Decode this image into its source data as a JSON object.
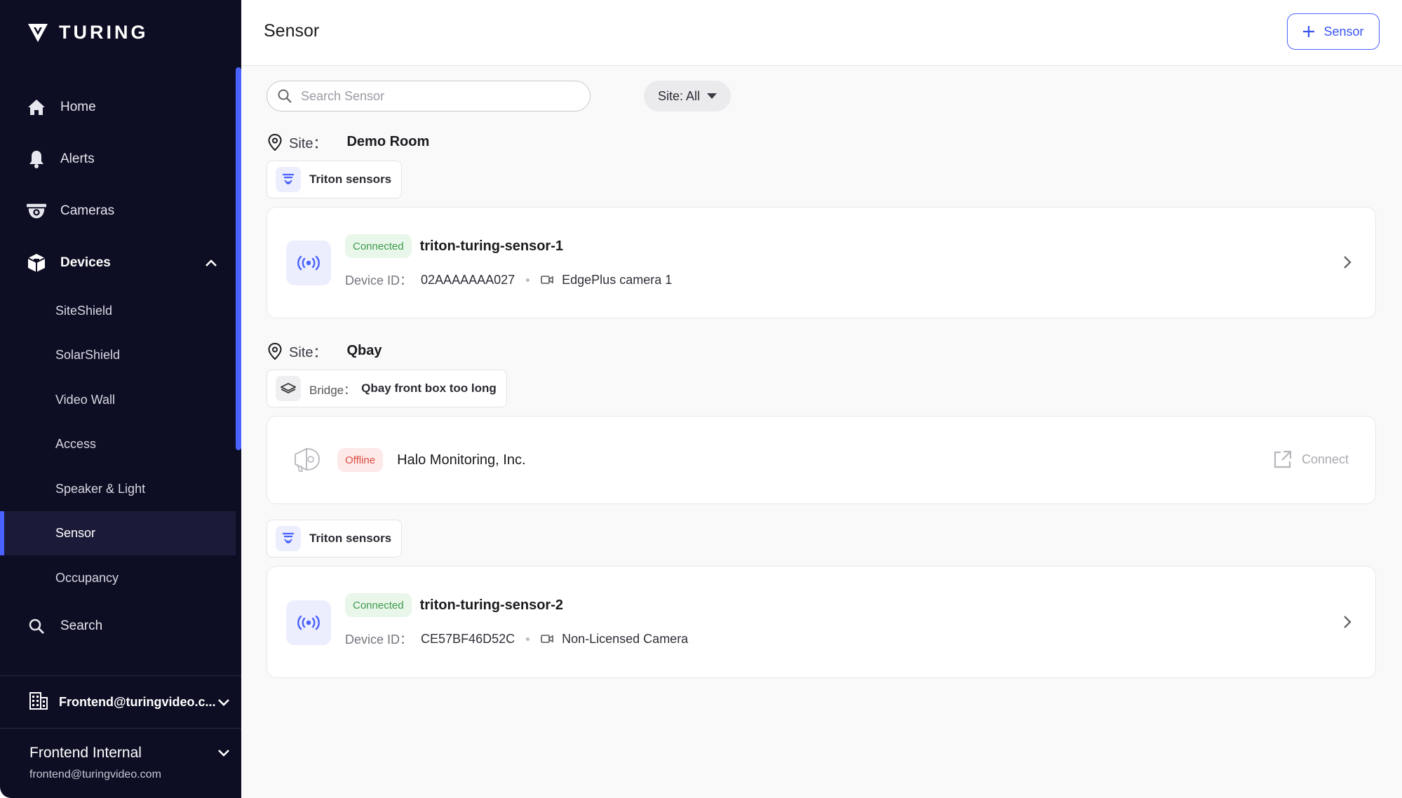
{
  "sidebar": {
    "brand": "TURING",
    "nav": [
      {
        "label": "Home",
        "icon": "home-icon"
      },
      {
        "label": "Alerts",
        "icon": "bell-icon"
      },
      {
        "label": "Cameras",
        "icon": "camera-icon"
      },
      {
        "label": "Devices",
        "icon": "cube-icon"
      }
    ],
    "devices_sub": [
      "SiteShield",
      "SolarShield",
      "Video Wall",
      "Access",
      "Speaker & Light",
      "Sensor",
      "Occupancy"
    ],
    "active_sub": "Sensor",
    "search_label": "Search",
    "org": "Frontend@turingvideo.c...",
    "user_name": "Frontend Internal",
    "user_email": "frontend@turingvideo.com"
  },
  "header": {
    "title": "Sensor",
    "add_label": "Sensor"
  },
  "filters": {
    "search_placeholder": "Search Sensor",
    "site_filter": "Site: All"
  },
  "sites": [
    {
      "label": "Site：",
      "name": "Demo Room",
      "group": "Triton sensors",
      "device": {
        "status": "Connected",
        "name": "triton-turing-sensor-1",
        "id_label": "Device ID：",
        "id": "02AAAAAAA027",
        "camera": "EdgePlus camera 1"
      }
    },
    {
      "label": "Site：",
      "name": "Qbay",
      "bridge_label": "Bridge：",
      "bridge_name": "Qbay front box too long",
      "halo": {
        "status": "Offline",
        "name": "Halo Monitoring, Inc.",
        "action": "Connect"
      },
      "group": "Triton sensors",
      "device": {
        "status": "Connected",
        "name": "triton-turing-sensor-2",
        "id_label": "Device ID：",
        "id": "CE57BF46D52C",
        "camera": "Non-Licensed Camera"
      }
    }
  ],
  "colors": {
    "sidebar_bg": "#0d0d24",
    "accent": "#4a62ff",
    "connected": "#3d9a4c",
    "offline": "#dc4d43"
  }
}
